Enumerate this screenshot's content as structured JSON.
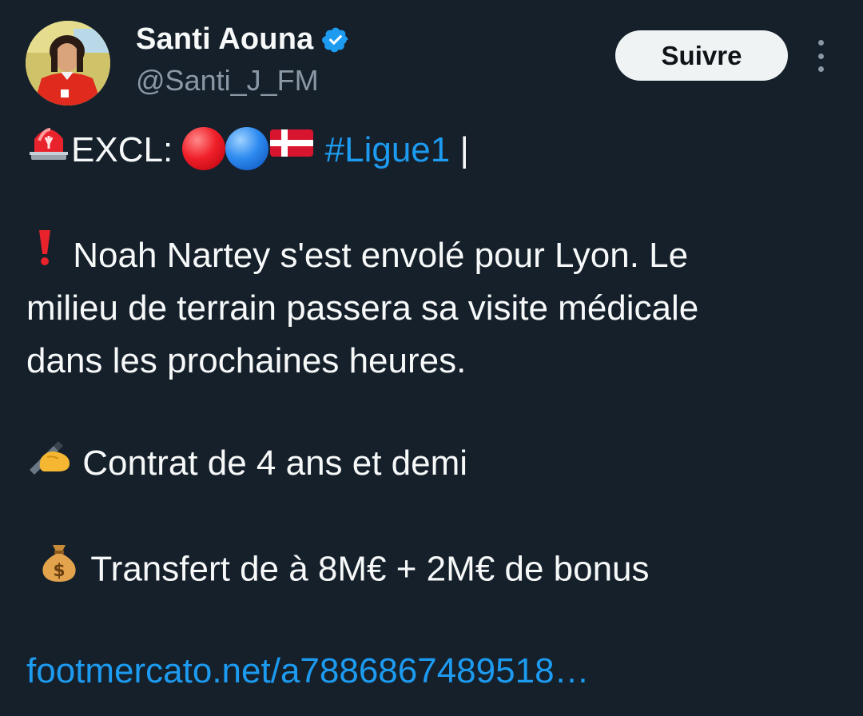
{
  "author": {
    "display_name": "Santi Aouna",
    "handle": "@Santi_J_FM",
    "verified": true
  },
  "actions": {
    "follow_label": "Suivre"
  },
  "icons": {
    "siren": "police-light-icon",
    "red_circle": "red-circle-icon",
    "blue_circle": "blue-circle-icon",
    "flag": "denmark-flag-icon",
    "exclamation": "exclamation-icon",
    "writing_hand": "writing-hand-icon",
    "money_bag": "money-bag-icon",
    "verified": "verified-badge-icon",
    "more": "more-options-icon"
  },
  "tweet": {
    "excl_label": "EXCL: ",
    "hashtag": "#Ligue1",
    "separator": " |",
    "para1_line1": " Noah Nartey s'est envolé pour Lyon. Le",
    "para1_line2": "milieu de terrain passera sa visite médicale",
    "para1_line3": "dans les prochaines heures.",
    "contract": " Contrat de 4 ans et demi",
    "transfer": " Transfert de à 8M€ + 2M€ de bonus",
    "link": "footmercato.net/a7886867489518…"
  },
  "colors": {
    "background": "#15202b",
    "text": "#f7f9f9",
    "secondary": "#8b98a5",
    "link": "#1d9bf0",
    "verified": "#1d9bf0"
  }
}
